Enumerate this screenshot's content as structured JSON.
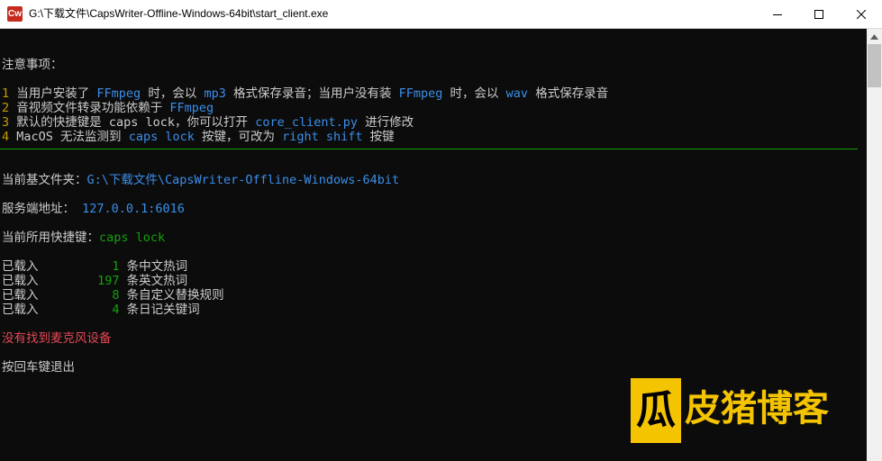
{
  "window": {
    "title": "G:\\下载文件\\CapsWriter-Offline-Windows-64bit\\start_client.exe",
    "icon_text": "Cw"
  },
  "console": {
    "notice_header": "注意事项：",
    "notes": [
      {
        "num": "1",
        "parts": [
          "当用户安装了 ",
          "FFmpeg",
          " 时，会以 ",
          "mp3",
          " 格式保存录音；当用户没有装 ",
          "FFmpeg",
          " 时，会以 ",
          "wav",
          " 格式保存录音"
        ]
      },
      {
        "num": "2",
        "parts": [
          "音视频文件转录功能依赖于 ",
          "FFmpeg"
        ]
      },
      {
        "num": "3",
        "parts": [
          "默认的快捷键是 caps lock，你可以打开 ",
          "core_client.py",
          " 进行修改"
        ]
      },
      {
        "num": "4",
        "parts": [
          "MacOS 无法监测到 ",
          "caps lock",
          " 按键，可改为 ",
          "right shift",
          " 按键"
        ]
      }
    ],
    "base_folder_label": "当前基文件夹：",
    "base_folder_value": "G:\\下载文件\\CapsWriter-Offline-Windows-64bit",
    "server_label": "服务端地址：",
    "server_value": " 127.0.0.1:6016",
    "hotkey_label": "当前所用快捷键：",
    "hotkey_value": "caps lock",
    "loaded": [
      {
        "prefix": "已载入",
        "count": "1",
        "desc": " 条中文热词"
      },
      {
        "prefix": "已载入",
        "count": "197",
        "desc": " 条英文热词"
      },
      {
        "prefix": "已载入",
        "count": "8",
        "desc": " 条自定义替换规则"
      },
      {
        "prefix": "已载入",
        "count": "4",
        "desc": " 条日记关键词"
      }
    ],
    "error": "没有找到麦克风设备",
    "exit_prompt": "按回车键退出"
  },
  "watermark": {
    "logo_char": "瓜",
    "text": "皮猪博客"
  },
  "colors": {
    "background": "#0c0c0c",
    "text": "#cccccc",
    "number": "#c19c00",
    "highlight": "#3b8eea",
    "green": "#13a10e",
    "error": "#e74856",
    "watermark": "#f5c400"
  },
  "icons": [
    "app-icon",
    "minimize-icon",
    "maximize-icon",
    "close-icon",
    "scroll-up-arrow-icon"
  ]
}
